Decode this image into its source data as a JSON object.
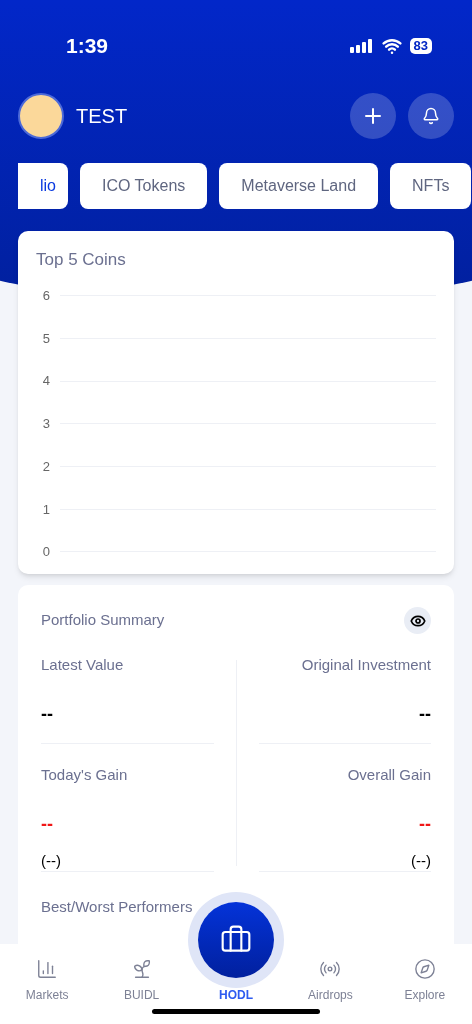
{
  "status_bar": {
    "time": "1:39",
    "battery": "83"
  },
  "header": {
    "username": "TEST"
  },
  "chips": [
    {
      "label": "lio",
      "selected": true
    },
    {
      "label": "ICO Tokens",
      "selected": false
    },
    {
      "label": "Metaverse Land",
      "selected": false
    },
    {
      "label": "NFTs",
      "selected": false
    }
  ],
  "chart_card": {
    "title": "Top 5 Coins",
    "axis_labels": [
      "6",
      "5",
      "4",
      "3",
      "2",
      "1",
      "0"
    ]
  },
  "portfolio_summary": {
    "title": "Portfolio Summary",
    "stats": [
      {
        "label": "Latest Value",
        "value": "--",
        "negative": false
      },
      {
        "label": "Original Investment",
        "value": "--",
        "negative": false
      },
      {
        "label": "Today's Gain",
        "value": "--",
        "negative": true,
        "change": "(--)"
      },
      {
        "label": "Overall Gain",
        "value": "--",
        "negative": true,
        "change": "(--)"
      }
    ],
    "next_section": "Best/Worst Performers"
  },
  "tab_bar": [
    {
      "label": "Markets",
      "selected": false
    },
    {
      "label": "BUIDL",
      "selected": false
    },
    {
      "label": "HODL",
      "selected": true
    },
    {
      "label": "Airdrops",
      "selected": false
    },
    {
      "label": "Explore",
      "selected": false
    }
  ]
}
